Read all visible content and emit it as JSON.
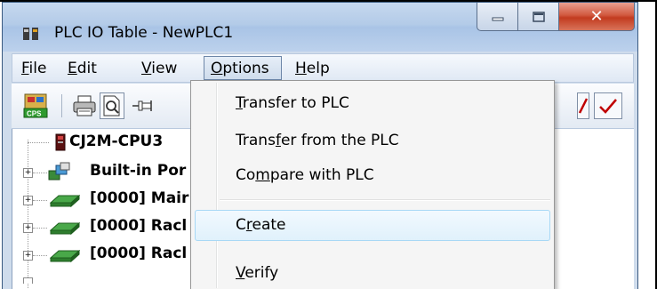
{
  "window": {
    "title": "PLC IO Table - NewPLC1",
    "caption_close": "✕",
    "app_icon": "plc-io-table-icon"
  },
  "menubar": {
    "items": [
      {
        "label_first": "F",
        "label_rest": "ile"
      },
      {
        "label_first": "E",
        "label_rest": "dit"
      },
      {
        "label_first": "V",
        "label_rest": "iew"
      },
      {
        "label_first": "O",
        "label_rest": "ptions"
      },
      {
        "label_first": "H",
        "label_rest": "elp"
      }
    ]
  },
  "toolbar": {
    "cps_label": "CPS",
    "icons": [
      "cps-icon",
      "print-icon",
      "print-preview-icon",
      "pin-icon",
      "delete-icon",
      "verify-check-icon"
    ]
  },
  "tree": {
    "items": [
      {
        "label": "CJ2M-CPU3",
        "icon": "cpu-icon",
        "expandable": false
      },
      {
        "label": "Built-in Por",
        "icon": "built-in-port-icon",
        "expandable": true
      },
      {
        "label": "[0000] Mair",
        "icon": "rack-icon",
        "expandable": true
      },
      {
        "label": "[0000] Racl",
        "icon": "rack-icon",
        "expandable": true
      },
      {
        "label": "[0000] Racl",
        "icon": "rack-icon",
        "expandable": true
      }
    ]
  },
  "options_menu": {
    "items": [
      {
        "before": "",
        "accel": "T",
        "after": "ransfer to PLC"
      },
      {
        "before": "Trans",
        "accel": "f",
        "after": "er from the PLC"
      },
      {
        "before": "Co",
        "accel": "m",
        "after": "pare with PLC"
      },
      {
        "before": "C",
        "accel": "r",
        "after": "eate"
      },
      {
        "before": "",
        "accel": "V",
        "after": "erify"
      }
    ],
    "hovered": "Create"
  },
  "colors": {
    "titlebar": "#b3cbe8",
    "close_button": "#c23b1f",
    "menu_hover_border": "#a8d8f5",
    "rack_green": "#2e8b2e"
  }
}
